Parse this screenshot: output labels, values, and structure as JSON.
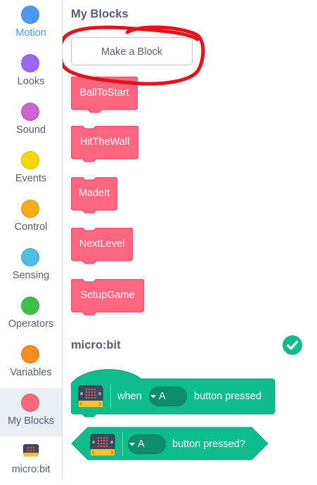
{
  "sidebar": {
    "categories": [
      {
        "label": "Motion",
        "color": "#4c97ff",
        "icon": "motion-dot-icon"
      },
      {
        "label": "Looks",
        "color": "#9966ff",
        "icon": "looks-dot-icon"
      },
      {
        "label": "Sound",
        "color": "#cf63cf",
        "icon": "sound-dot-icon"
      },
      {
        "label": "Events",
        "color": "#ffd500",
        "icon": "events-dot-icon"
      },
      {
        "label": "Control",
        "color": "#ffab19",
        "icon": "control-dot-icon"
      },
      {
        "label": "Sensing",
        "color": "#4cbfe6",
        "icon": "sensing-dot-icon"
      },
      {
        "label": "Operators",
        "color": "#40bf4a",
        "icon": "operators-dot-icon"
      },
      {
        "label": "Variables",
        "color": "#ff8c1a",
        "icon": "variables-dot-icon"
      },
      {
        "label": "My Blocks",
        "color": "#ff6680",
        "icon": "my-blocks-dot-icon"
      },
      {
        "label": "micro:bit",
        "icon": "microbit-board-icon"
      }
    ]
  },
  "palette": {
    "my_blocks": {
      "title": "My Blocks",
      "make_block_label": "Make a Block",
      "blocks": [
        "BallToStart",
        "HitTheWall",
        "MadeIt",
        "NextLevel",
        "SetupGame"
      ],
      "block_color": "#ff6680"
    },
    "microbit": {
      "title": "micro:bit",
      "status_icon": "check-circle-icon",
      "status_color": "#0fbd8c",
      "when_block": {
        "prefix": "when",
        "option": "A",
        "suffix": "button pressed"
      },
      "bool_block": {
        "option": "A",
        "suffix": "button pressed?"
      },
      "block_color": "#0fbd8c"
    }
  },
  "annotation": {
    "color": "#e3131b"
  }
}
